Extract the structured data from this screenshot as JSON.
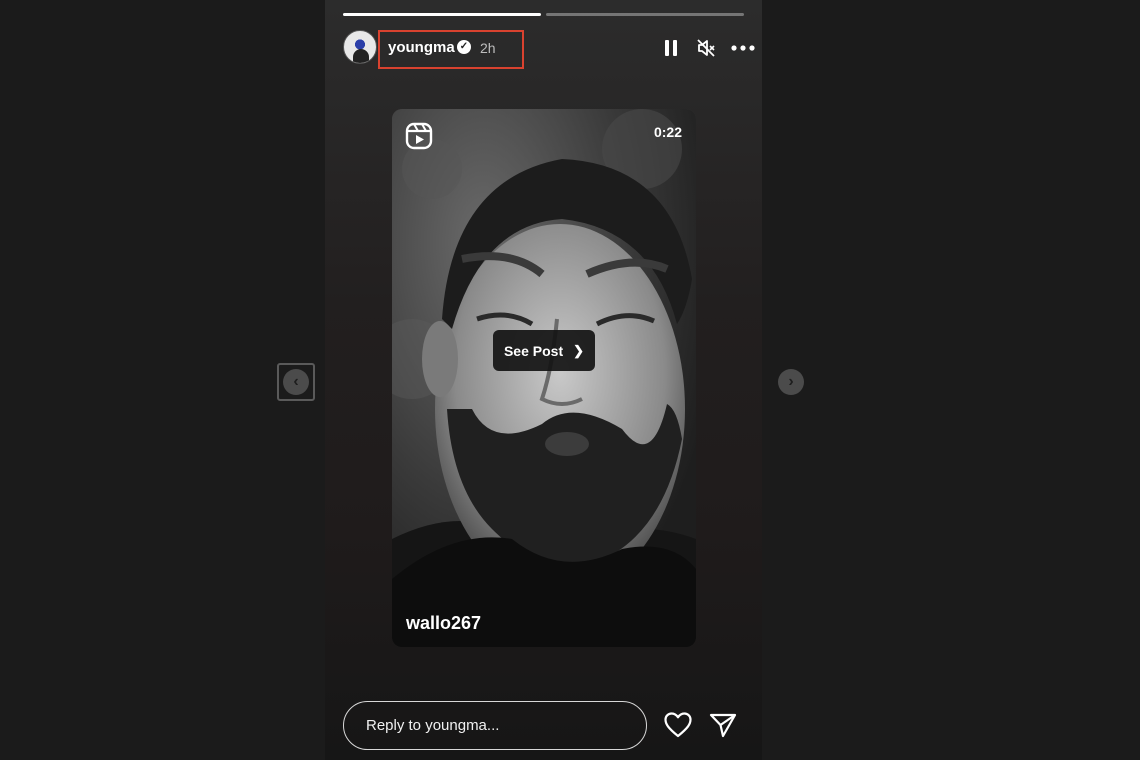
{
  "story": {
    "progress": [
      1.0,
      0.0
    ],
    "username": "youngma",
    "verified": true,
    "time_ago": "2h",
    "highlight_color": "#d9422f"
  },
  "reel": {
    "duration": "0:22",
    "see_post_label": "See Post",
    "creator": "wallo267",
    "icon": "reels-icon"
  },
  "header_controls": {
    "icons": [
      "pause-icon",
      "mute-icon",
      "more-icon"
    ]
  },
  "reply": {
    "placeholder": "Reply to youngma...",
    "icons": [
      "heart-icon",
      "send-icon"
    ]
  },
  "navigation": {
    "prev_icon": "chevron-left-icon",
    "next_icon": "chevron-right-icon",
    "prev_symbol": "‹",
    "next_symbol": "›"
  }
}
